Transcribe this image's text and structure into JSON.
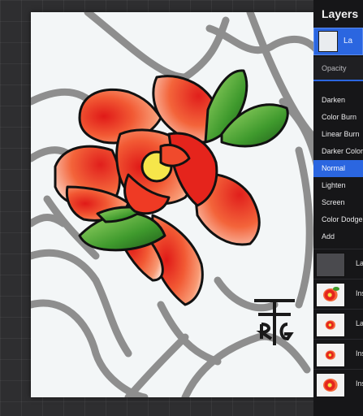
{
  "layers_panel": {
    "title": "Layers",
    "active_layer_label": "La",
    "opacity_label": "Opacity",
    "blend_modes": [
      {
        "label": "Darken"
      },
      {
        "label": "Color Burn"
      },
      {
        "label": "Linear Burn"
      },
      {
        "label": "Darker Color"
      },
      {
        "label": "Normal",
        "selected": true
      },
      {
        "label": "Lighten"
      },
      {
        "label": "Screen"
      },
      {
        "label": "Color Dodge"
      },
      {
        "label": "Add"
      }
    ],
    "layers": [
      {
        "label": "La",
        "thumb": "empty"
      },
      {
        "label": "Ins",
        "thumb": "flower"
      },
      {
        "label": "La",
        "thumb": "flower-small"
      },
      {
        "label": "Ins",
        "thumb": "flower-small"
      },
      {
        "label": "Ins",
        "thumb": "flower"
      }
    ],
    "accent_color": "#2b66e0"
  },
  "canvas": {
    "signature_text": "RTG",
    "colors": {
      "petal_red": "#e5241c",
      "petal_orange": "#f46a3a",
      "leaf_green": "#3e9a2c",
      "center_yellow": "#f6e64a",
      "sketch_gray": "#8e8e8e"
    }
  }
}
